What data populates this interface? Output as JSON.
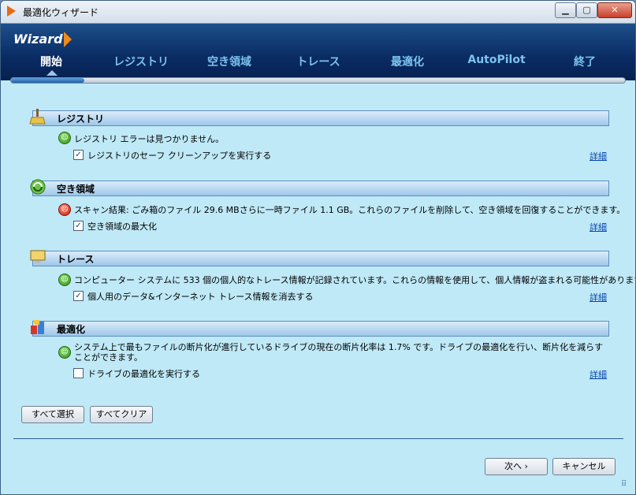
{
  "window": {
    "title": "最適化ウィザード",
    "min_label": "▁",
    "max_label": "▢",
    "close_label": "✕"
  },
  "header": {
    "logo": "Wizard",
    "tabs": [
      {
        "label": "開始",
        "active": true
      },
      {
        "label": "レジストリ",
        "active": false
      },
      {
        "label": "空き領域",
        "active": false
      },
      {
        "label": "トレース",
        "active": false
      },
      {
        "label": "最適化",
        "active": false
      },
      {
        "label": "AutoPilot",
        "active": false
      },
      {
        "label": "終了",
        "active": false
      }
    ],
    "progress_fraction": 0.12
  },
  "sections": [
    {
      "title": "レジストリ",
      "icon": "broom-icon",
      "status": "ok",
      "message": "レジストリ エラーは見つかりません。",
      "checkbox": {
        "label": "レジストリのセーフ クリーンアップを実行する",
        "checked": true
      },
      "detail": "詳細"
    },
    {
      "title": "空き領域",
      "icon": "recycle-icon",
      "status": "error",
      "message": "スキャン結果: ごみ箱のファイル 29.6 MBさらに一時ファイル 1.1 GB。これらのファイルを削除して、空き領域を回復することができます。",
      "checkbox": {
        "label": "空き領域の最大化",
        "checked": true
      },
      "detail": "詳細"
    },
    {
      "title": "トレース",
      "icon": "monitor-icon",
      "status": "ok",
      "message": "コンピューター システムに 533 個の個人的なトレース情報が記録されています。これらの情報を使用して、個人情報が盗まれる可能性があります。",
      "checkbox": {
        "label": "個人用のデータ&インターネット トレース情報を消去する",
        "checked": true
      },
      "detail": "詳細"
    },
    {
      "title": "最適化",
      "icon": "defrag-icon",
      "status": "ok",
      "message": "システム上で最もファイルの断片化が進行しているドライブの現在の断片化率は 1.7% です。ドライブの最適化を行い、断片化を減らすことができます。",
      "checkbox": {
        "label": "ドライブの最適化を実行する",
        "checked": false
      },
      "detail": "詳細"
    }
  ],
  "buttons": {
    "select_all": "すべて選択",
    "clear_all": "すべてクリア",
    "next": "次へ",
    "cancel": "キャンセル"
  },
  "colors": {
    "accent": "#0a2b63",
    "background": "#bfe9f7",
    "ok": "#2f8f19",
    "error": "#c21c0c"
  }
}
